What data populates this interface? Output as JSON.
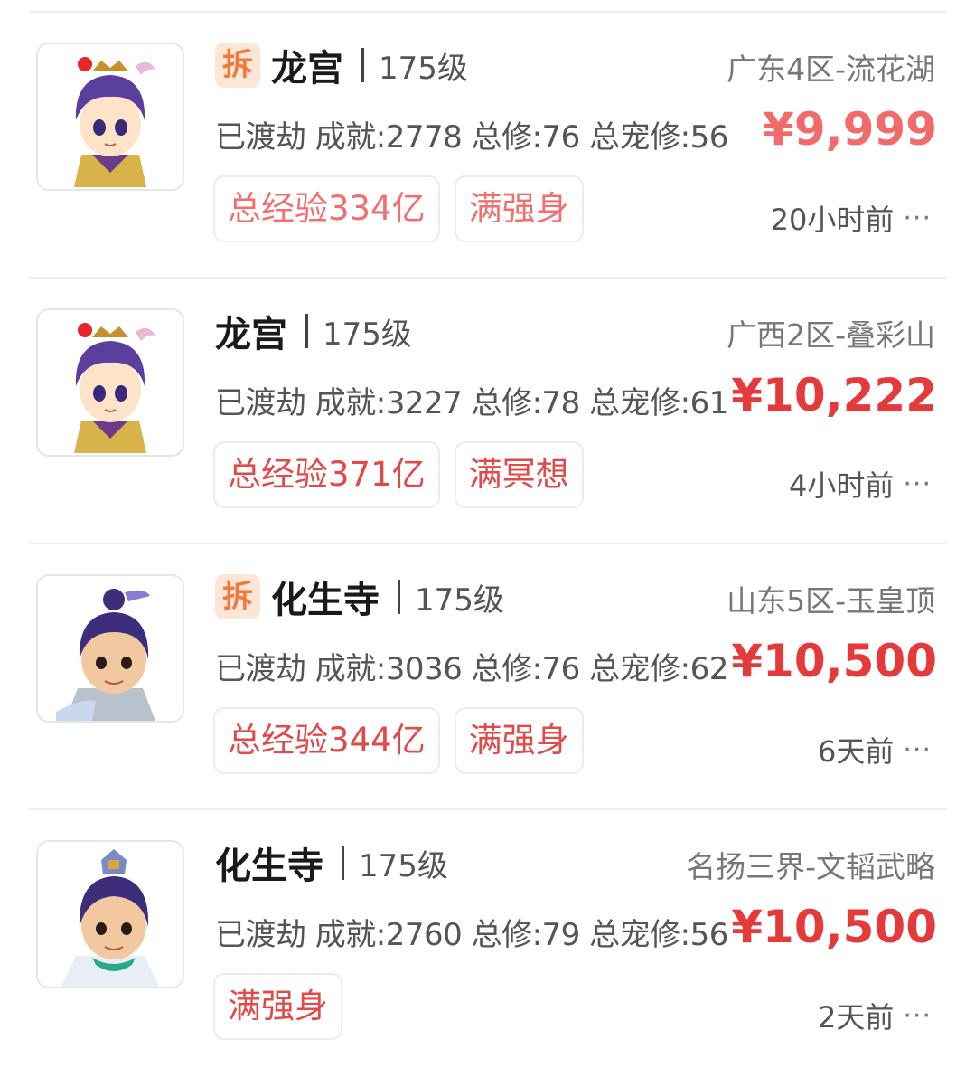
{
  "listings": [
    {
      "chai": "拆",
      "school": "龙宫",
      "level": "175级",
      "server": "广东4区-流花湖",
      "stats": "已渡劫 成就:2778 总修:76 总宠修:56",
      "price": "¥9,999",
      "tags": [
        "总经验334亿",
        "满强身"
      ],
      "time": "20小时前",
      "more": "···"
    },
    {
      "school": "龙宫",
      "level": "175级",
      "server": "广西2区-叠彩山",
      "stats": "已渡劫 成就:3227 总修:78 总宠修:61",
      "price": "¥10,222",
      "tags": [
        "总经验371亿",
        "满冥想"
      ],
      "time": "4小时前",
      "more": "···"
    },
    {
      "chai": "拆",
      "school": "化生寺",
      "level": "175级",
      "server": "山东5区-玉皇顶",
      "stats": "已渡劫 成就:3036 总修:76 总宠修:62",
      "price": "¥10,500",
      "tags": [
        "总经验344亿",
        "满强身"
      ],
      "time": "6天前",
      "more": "···"
    },
    {
      "school": "化生寺",
      "level": "175级",
      "server": "名扬三界-文韬武略",
      "stats": "已渡劫 成就:2760 总修:79 总宠修:56",
      "price": "¥10,500",
      "tags": [
        "满强身"
      ],
      "time": "2天前",
      "more": "···"
    }
  ]
}
